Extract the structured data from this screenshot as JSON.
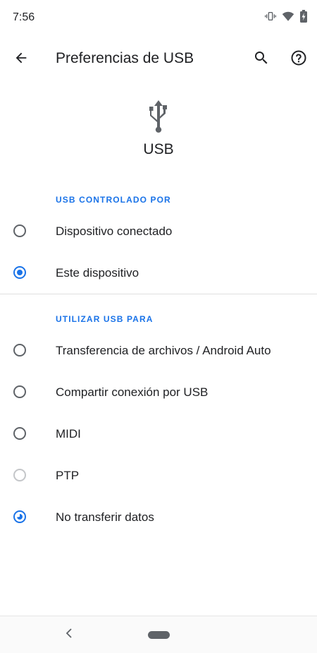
{
  "status_bar": {
    "time": "7:56",
    "icons": [
      "vibrate-icon",
      "wifi-icon",
      "battery-charging-icon"
    ]
  },
  "toolbar": {
    "title": "Preferencias de USB",
    "back_icon": "arrow-back-icon",
    "search_icon": "search-icon",
    "help_icon": "help-icon"
  },
  "header": {
    "icon": "usb-icon",
    "title": "USB"
  },
  "controlled_by": {
    "header": "USB CONTROLADO POR",
    "options": [
      {
        "label": "Dispositivo conectado",
        "selected": false
      },
      {
        "label": "Este dispositivo",
        "selected": true
      }
    ]
  },
  "use_for": {
    "header": "UTILIZAR USB PARA",
    "options": [
      {
        "label": "Transferencia de archivos / Android Auto",
        "selected": false
      },
      {
        "label": "Compartir conexión por USB",
        "selected": false
      },
      {
        "label": "MIDI",
        "selected": false
      },
      {
        "label": "PTP",
        "selected": false
      },
      {
        "label": "No transferir datos",
        "selected": true
      }
    ]
  },
  "colors": {
    "accent": "#1a73e8",
    "text": "#202124",
    "radio_unchecked": "#5f6368"
  },
  "nav_bar": {
    "back_icon": "nav-back-icon",
    "home_icon": "nav-home-pill"
  }
}
